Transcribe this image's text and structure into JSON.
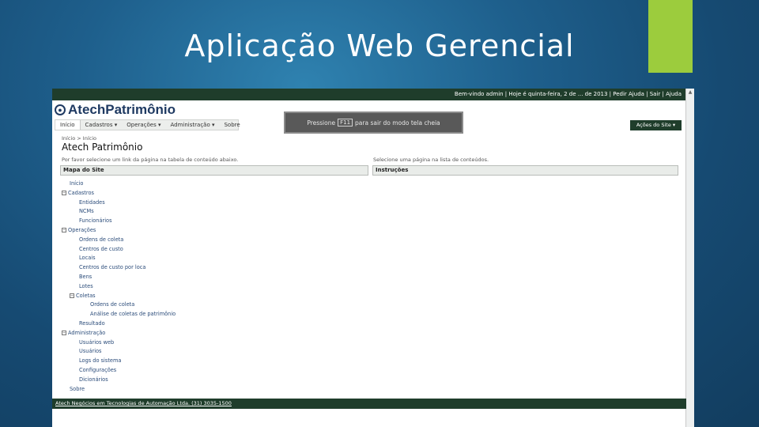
{
  "slide": {
    "title": "Aplicação Web Gerencial"
  },
  "colors": {
    "accent": "#9ccc3d",
    "header_green": "#1f3d2b",
    "link": "#2b4c7a"
  },
  "app": {
    "topbar_text": "Bem-vindo admin | Hoje é quinta-feira, 2 de ... de 2013 | Pedir Ajuda | Sair | Ajuda",
    "logo_text": "AtechPatrimônio",
    "nav": [
      "Início",
      "Cadastros ▾",
      "Operações ▾",
      "Administração ▾",
      "Sobre"
    ],
    "hint": {
      "prefix": "Pressione",
      "key": "F11",
      "suffix": "para sair do modo tela cheia"
    },
    "site_actions": "Ações do Site ▾",
    "breadcrumb": "Início > Início",
    "page_title": "Atech Patrimônio",
    "left_desc": "Por favor selecione um link da página na tabela de conteúdo abaixo.",
    "right_desc": "Selecione uma página na lista de conteúdos.",
    "left_panel": "Mapa do Site",
    "right_panel": "Instruções",
    "tree": [
      {
        "label": "Início",
        "level": 1,
        "box": ""
      },
      {
        "label": "Cadastros",
        "level": 0,
        "box": "−"
      },
      {
        "label": "Entidades",
        "level": 2,
        "box": ""
      },
      {
        "label": "NCMs",
        "level": 2,
        "box": ""
      },
      {
        "label": "Funcionários",
        "level": 2,
        "box": ""
      },
      {
        "label": "Operações",
        "level": 0,
        "box": "−"
      },
      {
        "label": "Ordens de coleta",
        "level": 2,
        "box": ""
      },
      {
        "label": "Centros de custo",
        "level": 2,
        "box": ""
      },
      {
        "label": "Locais",
        "level": 2,
        "box": ""
      },
      {
        "label": "Centros de custo por loca",
        "level": 2,
        "box": ""
      },
      {
        "label": "Bens",
        "level": 2,
        "box": ""
      },
      {
        "label": "Lotes",
        "level": 2,
        "box": ""
      },
      {
        "label": "Coletas",
        "level": 1,
        "box": "−"
      },
      {
        "label": "Ordens de coleta",
        "level": 3,
        "box": ""
      },
      {
        "label": "Análise de coletas de patrimônio",
        "level": 3,
        "box": ""
      },
      {
        "label": "Resultado",
        "level": 2,
        "box": ""
      },
      {
        "label": "Administração",
        "level": 0,
        "box": "−"
      },
      {
        "label": "Usuários web",
        "level": 2,
        "box": ""
      },
      {
        "label": "Usuários",
        "level": 2,
        "box": ""
      },
      {
        "label": "Logs do sistema",
        "level": 2,
        "box": ""
      },
      {
        "label": "Configurações",
        "level": 2,
        "box": ""
      },
      {
        "label": "Dicionários",
        "level": 2,
        "box": ""
      },
      {
        "label": "Sobre",
        "level": 1,
        "box": ""
      }
    ],
    "footer": "Atech Negócios em Tecnologias de Automação Ltda. (31) 3035-1500"
  }
}
